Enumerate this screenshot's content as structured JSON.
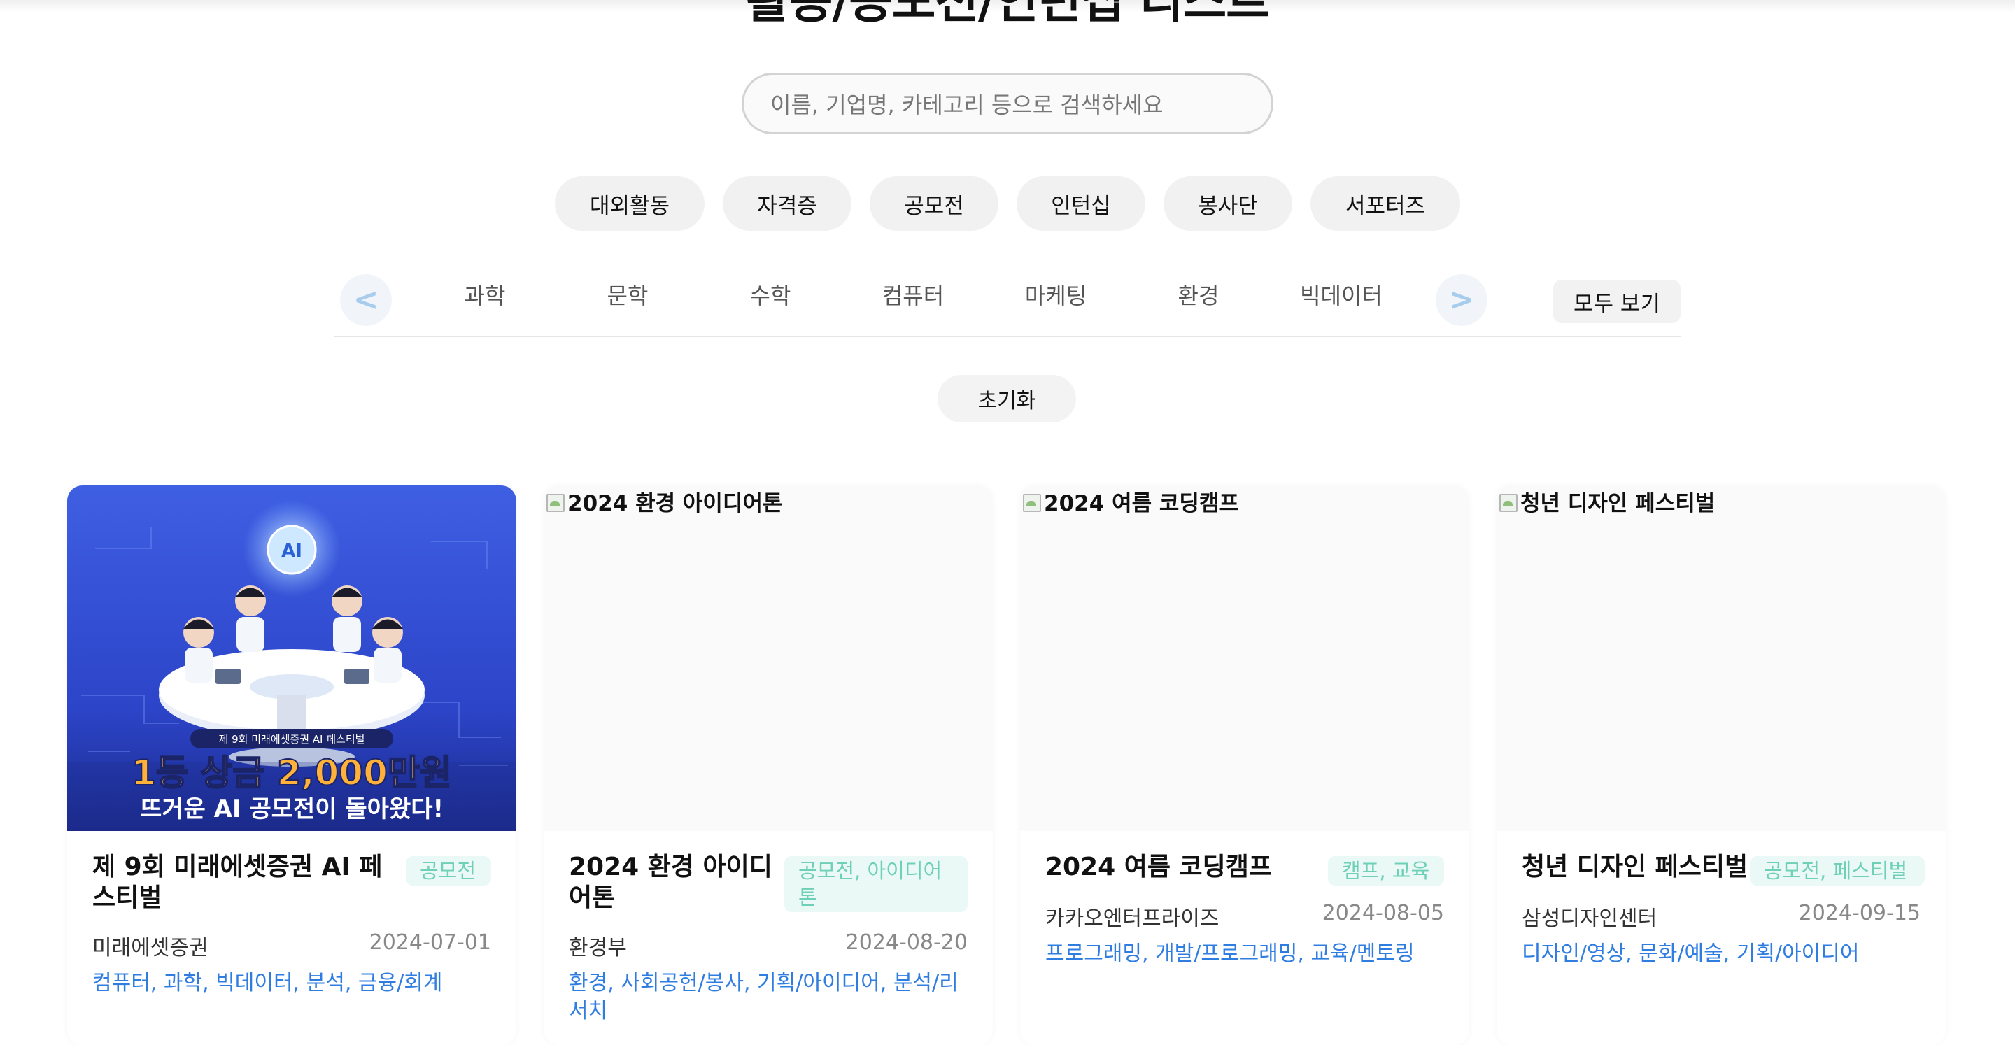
{
  "page": {
    "title": "활동/공모전/인턴십 리스트"
  },
  "search": {
    "placeholder": "이름, 기업명, 카테고리 등으로 검색하세요"
  },
  "categories": [
    "대외활동",
    "자격증",
    "공모전",
    "인턴십",
    "봉사단",
    "서포터즈"
  ],
  "fields": {
    "prev_label": "<",
    "next_label": ">",
    "items": [
      "과학",
      "문학",
      "수학",
      "컴퓨터",
      "마케팅",
      "환경",
      "빅데이터"
    ],
    "view_all_label": "모두 보기"
  },
  "reset_label": "초기화",
  "image_poster": {
    "event_name": "제 9회 미래에셋증권 AI 페스티벌",
    "headline": "1등 상금 2,000만원",
    "subline": "뜨거운 AI 공모전이 돌아왔다!"
  },
  "cards": [
    {
      "title": "제 9회 미래에셋증권 AI 페스티벌",
      "tag": "공모전",
      "org": "미래에셋증권",
      "date": "2024-07-01",
      "fields": "컴퓨터, 과학, 빅데이터, 분석, 금융/회계"
    },
    {
      "image_alt": "2024 환경 아이디어톤",
      "title": "2024 환경 아이디어톤",
      "tag": "공모전, 아이디어톤",
      "org": "환경부",
      "date": "2024-08-20",
      "fields": "환경, 사회공헌/봉사, 기획/아이디어, 분석/리서치"
    },
    {
      "image_alt": "2024 여름 코딩캠프",
      "title": "2024 여름 코딩캠프",
      "tag": "캠프, 교육",
      "org": "카카오엔터프라이즈",
      "date": "2024-08-05",
      "fields": "프로그래밍, 개발/프로그래밍, 교육/멘토링"
    },
    {
      "image_alt": "청년 디자인 페스티벌",
      "title": "청년 디자인 페스티벌",
      "tag": "공모전, 페스티벌",
      "org": "삼성디자인센터",
      "date": "2024-09-15",
      "fields": "디자인/영상, 문화/예술, 기획/아이디어"
    }
  ],
  "colors": {
    "accent_blue": "#2f7de1",
    "tag_mint_text": "#6fd0b8",
    "tag_mint_bg": "#eaf9f5",
    "arrow_blue": "#a8cdec"
  }
}
